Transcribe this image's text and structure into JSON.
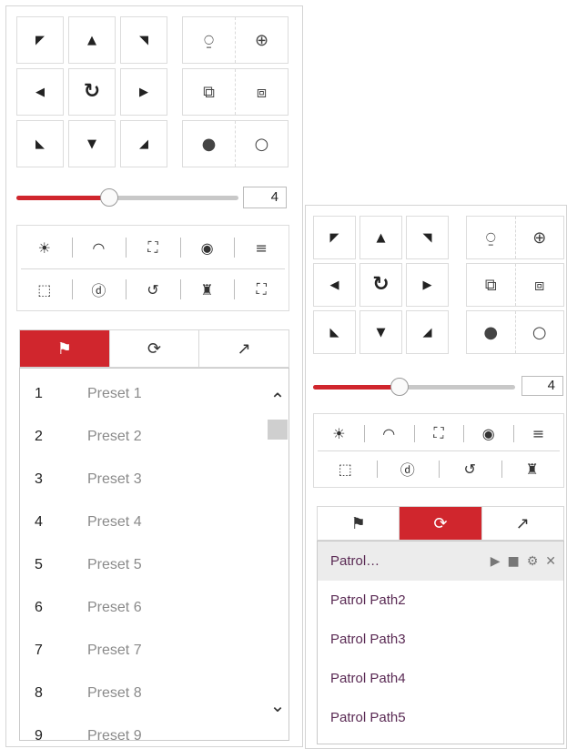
{
  "accent_color": "#d0262d",
  "left_panel": {
    "ptz_buttons": [
      {
        "name": "pan-up-left-button",
        "icon": "up-left-arrow-icon",
        "glyph": "◤"
      },
      {
        "name": "pan-up-button",
        "icon": "up-arrow-icon",
        "glyph": "▲"
      },
      {
        "name": "pan-up-right-button",
        "icon": "up-right-arrow-icon",
        "glyph": "◥"
      },
      {
        "name": "pan-left-button",
        "icon": "left-arrow-icon",
        "glyph": "◀"
      },
      {
        "name": "auto-pan-button",
        "icon": "rotate-icon",
        "glyph": "↻"
      },
      {
        "name": "pan-right-button",
        "icon": "right-arrow-icon",
        "glyph": "▶"
      },
      {
        "name": "pan-down-left-button",
        "icon": "down-left-arrow-icon",
        "glyph": "◣"
      },
      {
        "name": "pan-down-button",
        "icon": "down-arrow-icon",
        "glyph": "▼"
      },
      {
        "name": "pan-down-right-button",
        "icon": "down-right-arrow-icon",
        "glyph": "◢"
      }
    ],
    "lens_rows": [
      {
        "left": {
          "name": "zoom-out-button",
          "icon": "zoom-out-icon",
          "glyph": "⍜"
        },
        "right": {
          "name": "zoom-in-button",
          "icon": "zoom-in-icon",
          "glyph": "⊕"
        }
      },
      {
        "left": {
          "name": "focus-near-button",
          "icon": "focus-near-icon",
          "glyph": "⧉"
        },
        "right": {
          "name": "focus-far-button",
          "icon": "focus-far-icon",
          "glyph": "⧈"
        }
      },
      {
        "left": {
          "name": "iris-close-button",
          "icon": "iris-close-icon",
          "glyph": "●"
        },
        "right": {
          "name": "iris-open-button",
          "icon": "iris-open-icon",
          "glyph": "○"
        }
      }
    ],
    "speed": {
      "value": "4",
      "level": 0.42
    },
    "tools_row1": [
      {
        "name": "light-button",
        "icon": "light-icon",
        "glyph": "☀"
      },
      {
        "name": "wiper-button",
        "icon": "wiper-icon",
        "glyph": "◠"
      },
      {
        "name": "auxiliary-focus-button",
        "icon": "auxiliary-focus-icon",
        "glyph": "⛶"
      },
      {
        "name": "lens-initialization-button",
        "icon": "lens-init-icon",
        "glyph": "◉"
      },
      {
        "name": "menu-button",
        "icon": "menu-icon",
        "glyph": "≡"
      }
    ],
    "tools_row2": [
      {
        "name": "manual-tracking-button",
        "icon": "manual-tracking-icon",
        "glyph": "⬚"
      },
      {
        "name": "zoom-3d-button",
        "icon": "zoom-3d-icon",
        "glyph": "ⓓ"
      },
      {
        "name": "one-touch-patrol-button",
        "icon": "one-touch-patrol-icon",
        "glyph": "↺"
      },
      {
        "name": "one-touch-park-button",
        "icon": "park-icon",
        "glyph": "♜"
      },
      {
        "name": "person-tracking-button",
        "icon": "person-tracking-icon",
        "glyph": "⛶"
      }
    ],
    "tabs": [
      {
        "name": "tab-preset",
        "icon": "flag-icon",
        "glyph": "⚑",
        "active": true
      },
      {
        "name": "tab-patrol",
        "icon": "patrol-icon",
        "glyph": "⟳",
        "active": false
      },
      {
        "name": "tab-pattern",
        "icon": "pattern-icon",
        "glyph": "↗",
        "active": false
      }
    ],
    "presets": [
      {
        "num": "1",
        "name": "Preset 1"
      },
      {
        "num": "2",
        "name": "Preset 2"
      },
      {
        "num": "3",
        "name": "Preset 3"
      },
      {
        "num": "4",
        "name": "Preset 4"
      },
      {
        "num": "5",
        "name": "Preset 5"
      },
      {
        "num": "6",
        "name": "Preset 6"
      },
      {
        "num": "7",
        "name": "Preset 7"
      },
      {
        "num": "8",
        "name": "Preset 8"
      },
      {
        "num": "9",
        "name": "Preset 9"
      }
    ],
    "scroll_up_glyph": "⌃",
    "scroll_down_glyph": "⌄"
  },
  "right_panel": {
    "speed": {
      "value": "4",
      "level": 0.43
    },
    "tools_row2": [
      {
        "name": "manual-tracking-button",
        "icon": "manual-tracking-icon",
        "glyph": "⬚"
      },
      {
        "name": "zoom-3d-button",
        "icon": "zoom-3d-icon",
        "glyph": "ⓓ"
      },
      {
        "name": "one-touch-patrol-button",
        "icon": "one-touch-patrol-icon",
        "glyph": "↺"
      },
      {
        "name": "one-touch-park-button",
        "icon": "park-icon",
        "glyph": "♜"
      }
    ],
    "tabs": [
      {
        "name": "tab-preset",
        "icon": "flag-icon",
        "glyph": "⚑",
        "active": false
      },
      {
        "name": "tab-patrol",
        "icon": "patrol-icon",
        "glyph": "⟳",
        "active": true
      },
      {
        "name": "tab-pattern",
        "icon": "pattern-icon",
        "glyph": "↗",
        "active": false
      }
    ],
    "patrols": [
      {
        "label": "Patrol…",
        "selected": true
      },
      {
        "label": "Patrol Path2",
        "selected": false
      },
      {
        "label": "Patrol Path3",
        "selected": false
      },
      {
        "label": "Patrol Path4",
        "selected": false
      },
      {
        "label": "Patrol Path5",
        "selected": false
      }
    ],
    "patrol_controls": [
      {
        "name": "play-button",
        "icon": "play-icon",
        "glyph": "▶"
      },
      {
        "name": "stop-button",
        "icon": "stop-icon",
        "glyph": "■"
      },
      {
        "name": "settings-button",
        "icon": "gear-icon",
        "glyph": "⚙"
      },
      {
        "name": "delete-button",
        "icon": "close-icon",
        "glyph": "✕"
      }
    ]
  }
}
